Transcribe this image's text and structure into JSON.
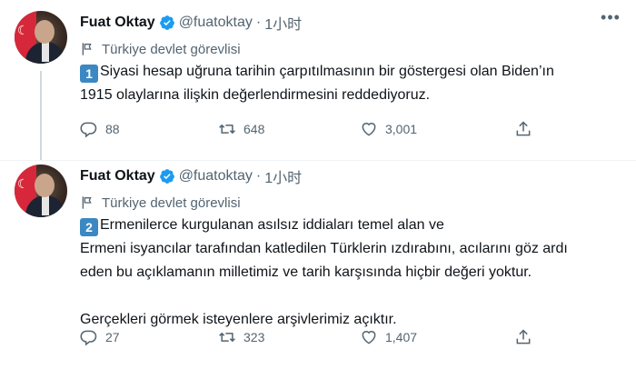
{
  "tweets": [
    {
      "author_name": "Fuat Oktay",
      "handle": "@fuatoktay",
      "separator": "·",
      "time": "1小时",
      "label": "Türkiye devlet görevlisi",
      "number_badge": "1",
      "paragraphs": [
        "Siyasi hesap uğruna tarihin çarpıtılmasının bir göstergesi olan Biden’ın",
        "1915 olaylarına ilişkin değerlendirmesini reddediyoruz."
      ],
      "replies": "88",
      "retweets": "648",
      "likes": "3,001"
    },
    {
      "author_name": "Fuat Oktay",
      "handle": "@fuatoktay",
      "separator": "·",
      "time": "1小时",
      "label": "Türkiye devlet görevlisi",
      "number_badge": "2",
      "paragraphs": [
        "Ermenilerce kurgulanan asılsız iddiaları temel alan ve",
        "Ermeni isyancılar tarafından katledilen Türklerin ızdırabını, acılarını göz ardı",
        "eden bu açıklamanın milletimiz ve tarih karşısında hiçbir değeri yoktur.",
        "Gerçekleri görmek isteyenlere arşivlerimiz açıktır."
      ],
      "replies": "27",
      "retweets": "323",
      "likes": "1,407"
    }
  ],
  "icons": {
    "verified": "verified-badge-icon",
    "label": "flag-icon",
    "more": "more-icon",
    "reply": "reply-icon",
    "retweet": "retweet-icon",
    "like": "heart-icon",
    "share": "share-icon"
  },
  "colors": {
    "accent": "#1d9bf0",
    "secondary_text": "#536471",
    "primary_text": "#0f1419",
    "keycap": "#3b88c3"
  }
}
